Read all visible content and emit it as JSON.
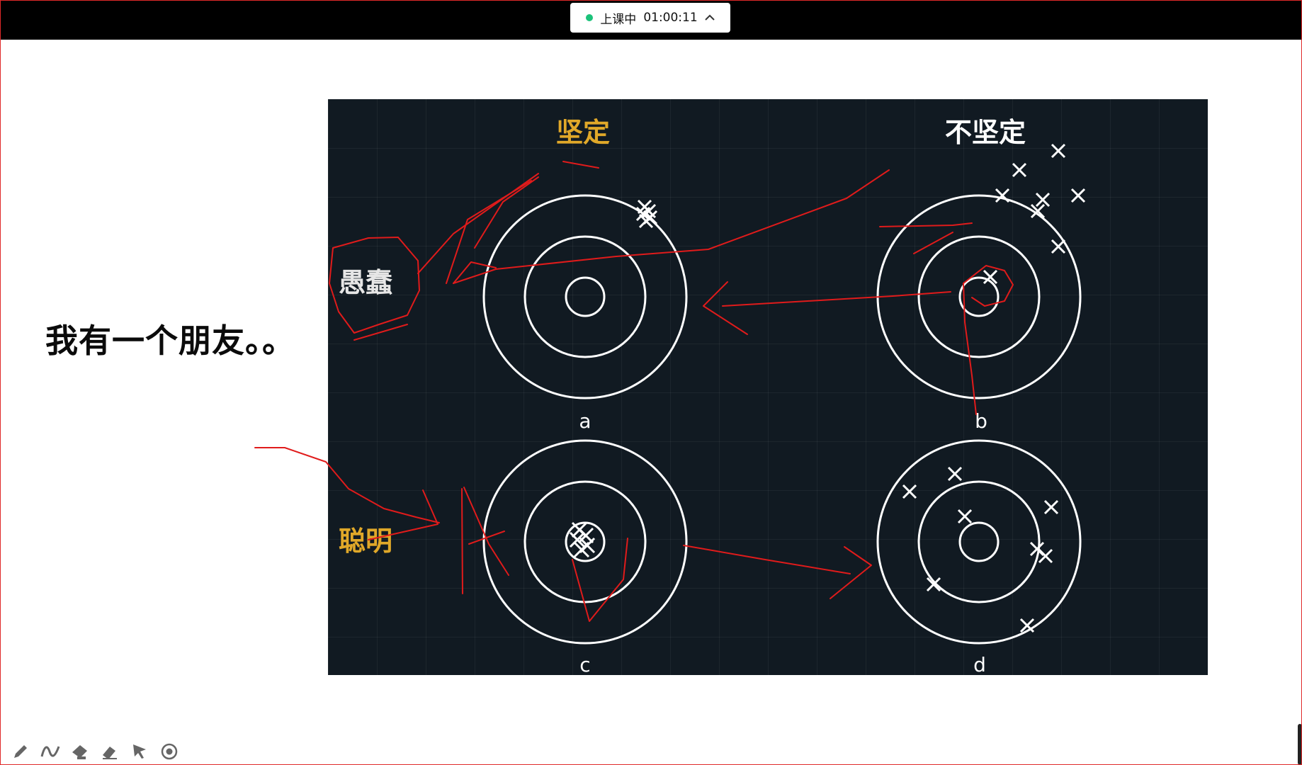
{
  "status": {
    "label": "上课中",
    "timer": "01:00:11"
  },
  "caption": "我有一个朋友。。",
  "slide": {
    "col_headers": {
      "firm": "坚定",
      "not_firm": "不坚定"
    },
    "row_labels": {
      "foolish": "愚蠢",
      "smart": "聪明"
    },
    "target_labels": [
      "a",
      "b",
      "c",
      "d"
    ],
    "colors": {
      "background": "#111a22",
      "accent": "#e0a829",
      "ink": "#ffffff",
      "annotation": "#e01b1b"
    }
  },
  "toolbar": {
    "tools": [
      "pen-icon",
      "curve-icon",
      "highlighter-icon",
      "eraser-icon",
      "pointer-icon",
      "laser-icon"
    ]
  }
}
